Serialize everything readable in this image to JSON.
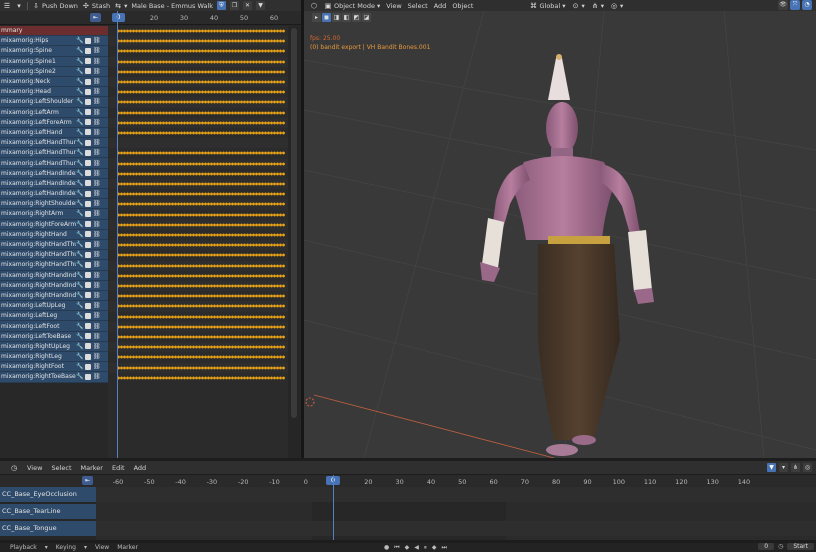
{
  "action_editor": {
    "header": {
      "push_down": "Push Down",
      "stash": "Stash",
      "action_name": "Male Base - Emmus Walk"
    },
    "ruler_ticks": [
      "0",
      "20",
      "30",
      "40",
      "50",
      "60"
    ],
    "current_frame": "0",
    "channels": [
      {
        "name": "mmary",
        "summary": true
      },
      {
        "name": "mixamorig:Hips"
      },
      {
        "name": "mixamorig:Spine"
      },
      {
        "name": "mixamorig:Spine1"
      },
      {
        "name": "mixamorig:Spine2"
      },
      {
        "name": "mixamorig:Neck"
      },
      {
        "name": "mixamorig:Head"
      },
      {
        "name": "mixamorig:LeftShoulder"
      },
      {
        "name": "mixamorig:LeftArm"
      },
      {
        "name": "mixamorig:LeftForeArm"
      },
      {
        "name": "mixamorig:LeftHand"
      },
      {
        "name": "mixamorig:LeftHandThun"
      },
      {
        "name": "mixamorig:LeftHandThun"
      },
      {
        "name": "mixamorig:LeftHandThun"
      },
      {
        "name": "mixamorig:LeftHandIndex"
      },
      {
        "name": "mixamorig:LeftHandIndex"
      },
      {
        "name": "mixamorig:LeftHandIndex"
      },
      {
        "name": "mixamorig:RightShoulder"
      },
      {
        "name": "mixamorig:RightArm"
      },
      {
        "name": "mixamorig:RightForeArm"
      },
      {
        "name": "mixamorig:RightHand"
      },
      {
        "name": "mixamorig:RightHandThu"
      },
      {
        "name": "mixamorig:RightHandThu"
      },
      {
        "name": "mixamorig:RightHandThu"
      },
      {
        "name": "mixamorig:RightHandInde"
      },
      {
        "name": "mixamorig:RightHandInde"
      },
      {
        "name": "mixamorig:RightHandInde"
      },
      {
        "name": "mixamorig:LeftUpLeg"
      },
      {
        "name": "mixamorig:LeftLeg"
      },
      {
        "name": "mixamorig:LeftFoot"
      },
      {
        "name": "mixamorig:LeftToeBase"
      },
      {
        "name": "mixamorig:RightUpLeg"
      },
      {
        "name": "mixamorig:RightLeg"
      },
      {
        "name": "mixamorig:RightFoot"
      },
      {
        "name": "mixamorig:RightToeBase"
      }
    ]
  },
  "viewport": {
    "header": {
      "mode": "Object Mode",
      "view": "View",
      "select": "Select",
      "add": "Add",
      "object": "Object",
      "transform_orientation": "Global"
    },
    "info_line1": "fps: 25.00",
    "info_line2": "(0) bandit export | VH Bandit Bones.001"
  },
  "timeline": {
    "header": {
      "view": "View",
      "select": "Select",
      "marker": "Marker",
      "edit": "Edit",
      "add": "Add"
    },
    "ruler_ticks": [
      "-60",
      "-50",
      "-40",
      "-30",
      "-20",
      "-10",
      "0",
      "0",
      "20",
      "30",
      "40",
      "50",
      "60",
      "70",
      "80",
      "90",
      "100",
      "110",
      "120",
      "130",
      "140"
    ],
    "current_frame": "0",
    "channels": [
      "CC_Base_EyeOcclusion",
      "CC_Base_TearLine",
      "CC_Base_Tongue"
    ]
  },
  "status_bar": {
    "playback": "Playback",
    "keying": "Keying",
    "view": "View",
    "marker": "Marker",
    "current_frame_field": "0",
    "start_label": "Start"
  }
}
